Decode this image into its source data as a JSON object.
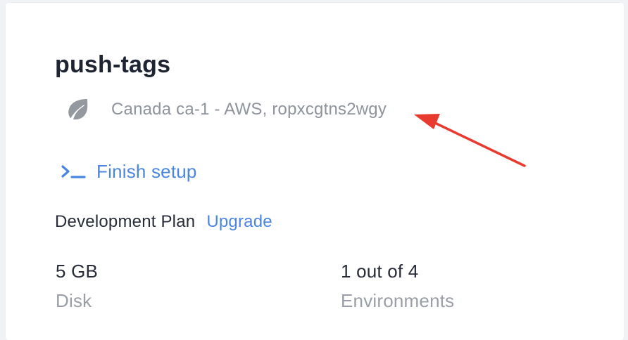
{
  "project": {
    "title": "push-tags",
    "region_text": "Canada ca-1 - AWS, ropxcgtns2wgy"
  },
  "icons": {
    "region": "leaf-icon",
    "setup": "terminal-prompt-icon",
    "annotation": "red-arrow-icon"
  },
  "setup": {
    "label": "Finish setup"
  },
  "plan": {
    "name": "Development Plan",
    "upgrade_label": "Upgrade"
  },
  "stats": [
    {
      "value": "5 GB",
      "label": "Disk"
    },
    {
      "value": "1 out of 4",
      "label": "Environments"
    }
  ],
  "colors": {
    "background": "#f1f2f5",
    "card": "#ffffff",
    "title": "#1f2433",
    "muted_text": "#8e939c",
    "link": "#4a86e0",
    "arrow": "#e83a2f"
  }
}
